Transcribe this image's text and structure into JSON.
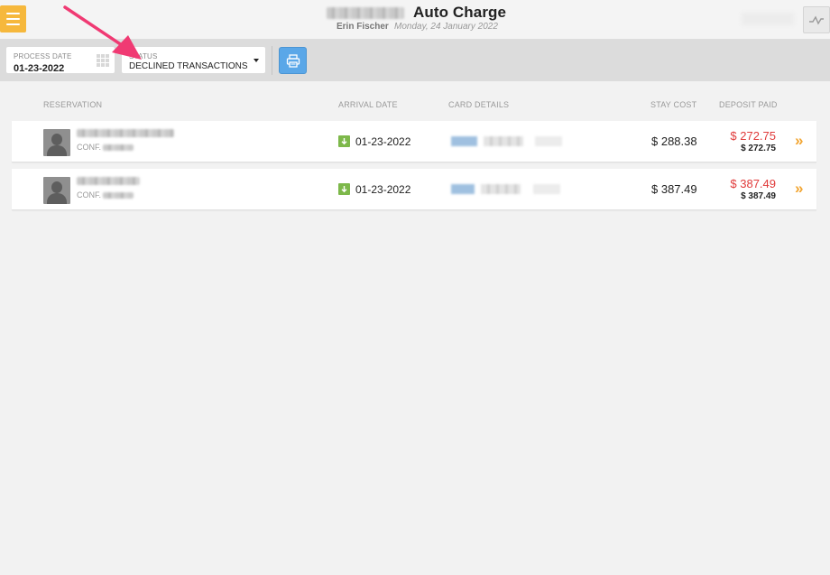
{
  "header": {
    "title": "Auto Charge",
    "user": "Erin Fischer",
    "date": "Monday, 24 January 2022"
  },
  "filters": {
    "process_date_label": "PROCESS DATE",
    "process_date_value": "01-23-2022",
    "status_label": "STATUS",
    "status_value": "DECLINED TRANSACTIONS"
  },
  "columns": {
    "reservation": "RESERVATION",
    "arrival_date": "ARRIVAL DATE",
    "card_details": "CARD DETAILS",
    "stay_cost": "STAY COST",
    "deposit_paid": "DEPOSIT PAID"
  },
  "rows": [
    {
      "conf_label": "CONF.",
      "arrival_date": "01-23-2022",
      "stay_cost": "$ 288.38",
      "deposit_paid": "$ 272.75",
      "deposit_paid_sub": "$ 272.75"
    },
    {
      "conf_label": "CONF.",
      "arrival_date": "01-23-2022",
      "stay_cost": "$ 387.49",
      "deposit_paid": "$ 387.49",
      "deposit_paid_sub": "$ 387.49"
    }
  ],
  "icons": {
    "menu": "hamburger-icon",
    "activity": "activity-icon",
    "calendar": "calendar-icon",
    "print": "print-icon",
    "arrival": "arrow-down-icon",
    "details": "double-chevron-right-icon"
  },
  "colors": {
    "menu_button": "#f6b83c",
    "print_button": "#5aa7e8",
    "arrival_badge": "#7db84a",
    "deposit_declined": "#e03a3a",
    "chevron": "#f2a531",
    "annotation_arrow": "#f03a73"
  }
}
